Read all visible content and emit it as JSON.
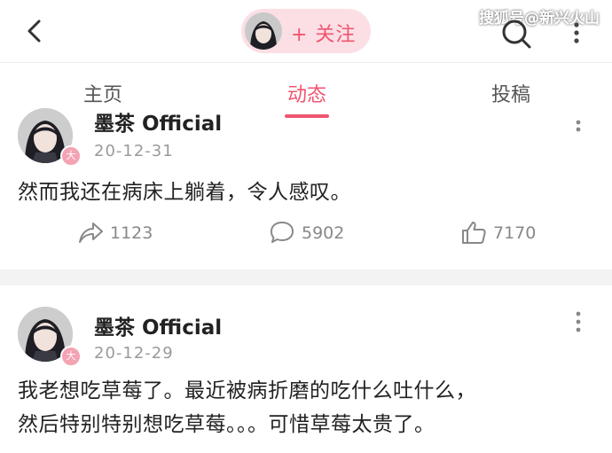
{
  "header": {
    "follow_label": "+ 关注",
    "watermark": "搜狐号@新兴火山"
  },
  "tabs": [
    {
      "label": "主页"
    },
    {
      "label": "动态"
    },
    {
      "label": "投稿"
    }
  ],
  "posts": [
    {
      "author": "墨茶 Official",
      "date": "20-12-31",
      "badge": "大",
      "text_lines": [
        "然而我还在病床上躺着，令人感叹。"
      ],
      "share_count": "1123",
      "comment_count": "5902",
      "like_count": "7170"
    },
    {
      "author": "墨茶 Official",
      "date": "20-12-29",
      "badge": "大",
      "text_lines": [
        "我老想吃草莓了。最近被病折磨的吃什么吐什么，",
        "然后特别特别想吃草莓。。。可惜草莓太贵了。"
      ]
    }
  ],
  "colors": {
    "accent": "#f0556f",
    "pill_bg": "#fbdfe4",
    "badge": "#f4a3b2"
  }
}
